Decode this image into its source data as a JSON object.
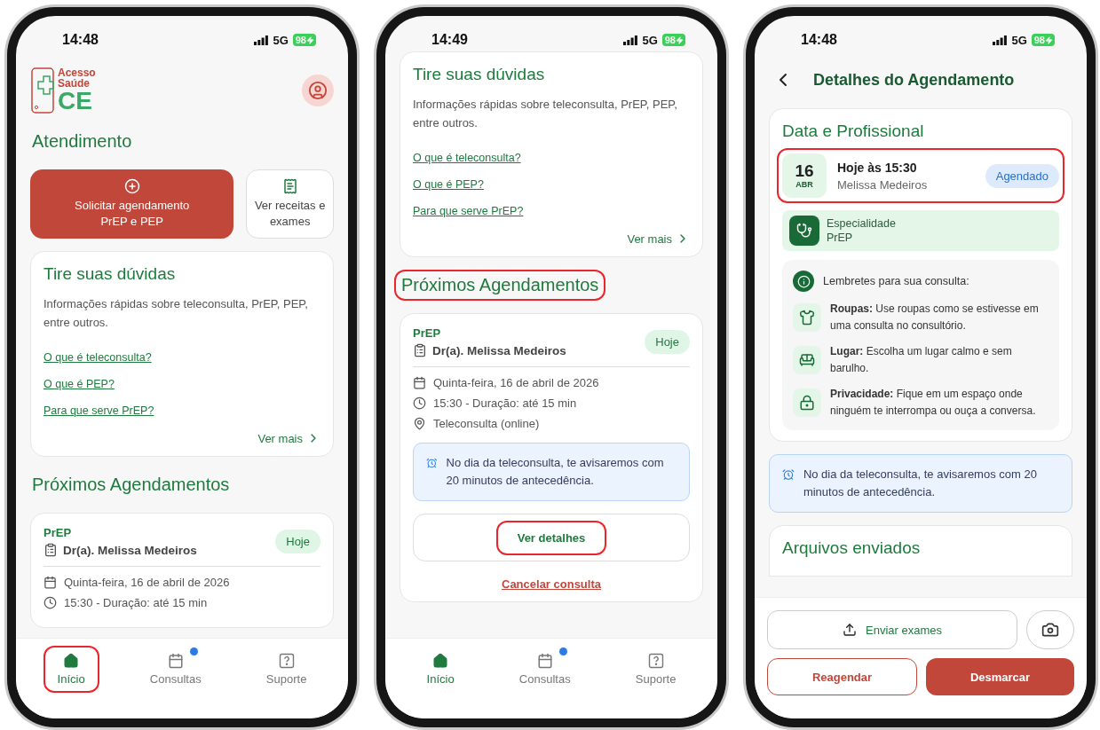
{
  "screens": [
    {
      "status": {
        "time": "14:48",
        "network": "5G",
        "battery": "98"
      },
      "blocks": [
        {
          "kind": "logo",
          "lines": [
            "Acesso",
            "Saúde",
            "CE"
          ]
        },
        {
          "kind": "heading",
          "text": "Atendimento",
          "highlighted": false
        },
        {
          "kind": "actions",
          "items": [
            {
              "label": "Solicitar agendamento PrEP e PEP",
              "primary": true
            },
            {
              "label": "Ver receitas e exames",
              "primary": false
            }
          ]
        },
        {
          "kind": "faq",
          "title": "Tire suas dúvidas",
          "text": "Informações rápidas sobre teleconsulta, PrEP, PEP, entre outros.",
          "links": [
            "O que é teleconsulta?",
            "O que é PEP?",
            "Para que serve PrEP?"
          ],
          "more": "Ver mais"
        },
        {
          "kind": "heading",
          "text": "Próximos Agendamentos",
          "highlighted": false
        },
        {
          "kind": "appointment",
          "type": "PrEP",
          "doctor": "Dr(a). Melissa Medeiros",
          "badge": "Hoje",
          "details": [
            "Quinta-feira, 16 de abril de 2026",
            "15:30 - Duração: até 15 min"
          ]
        }
      ],
      "tabs": [
        {
          "label": "Início",
          "selected": true,
          "highlighted": true,
          "dot": false
        },
        {
          "label": "Consultas",
          "selected": false,
          "highlighted": false,
          "dot": true
        },
        {
          "label": "Suporte",
          "selected": false,
          "highlighted": false,
          "dot": false
        }
      ]
    },
    {
      "status": {
        "time": "14:49",
        "network": "5G",
        "battery": "98"
      },
      "blocks": [
        {
          "kind": "faq",
          "title": "Tire suas dúvidas",
          "text": "Informações rápidas sobre teleconsulta, PrEP, PEP, entre outros.",
          "links": [
            "O que é teleconsulta?",
            "O que é PEP?",
            "Para que serve PrEP?"
          ],
          "more": "Ver mais"
        },
        {
          "kind": "heading",
          "text": "Próximos Agendamentos",
          "highlighted": true
        },
        {
          "kind": "appointment",
          "type": "PrEP",
          "doctor": "Dr(a). Melissa Medeiros",
          "badge": "Hoje",
          "details": [
            "Quinta-feira, 16 de abril de 2026",
            "15:30 - Duração: até 15 min",
            "Teleconsulta (online)"
          ],
          "notice": "No dia da teleconsulta, te avisaremos com 20 minutos de antecedência.",
          "button": {
            "label": "Ver detalhes",
            "highlighted": true
          },
          "cancel": "Cancelar consulta"
        }
      ],
      "tabs": [
        {
          "label": "Início",
          "selected": true,
          "highlighted": false,
          "dot": false
        },
        {
          "label": "Consultas",
          "selected": false,
          "highlighted": false,
          "dot": true
        },
        {
          "label": "Suporte",
          "selected": false,
          "highlighted": false,
          "dot": false
        }
      ]
    },
    {
      "status": {
        "time": "14:48",
        "network": "5G",
        "battery": "98"
      },
      "blocks": [
        {
          "kind": "nav",
          "title": "Detalhes do Agendamento"
        },
        {
          "kind": "detail",
          "title": "Data e Profissional",
          "day": "16",
          "month": "ABR",
          "when": "Hoje às 15:30",
          "who": "Melissa Medeiros",
          "status": "Agendado",
          "highlighted": true,
          "specialty_label": "Especialidade",
          "specialty": "PrEP",
          "reminders_title": "Lembretes para sua consulta:",
          "reminders": [
            "**Roupas:** Use roupas como se estivesse em uma consulta no consultório.",
            "**Lugar:** Escolha um lugar calmo e sem barulho.",
            "**Privacidade:** Fique em um espaço onde ninguém te interrompa ou ouça a conversa."
          ]
        },
        {
          "kind": "notice",
          "text": "No dia da teleconsulta, te avisaremos com 20 minutos de antecedência."
        },
        {
          "kind": "partial",
          "text": "Arquivos enviados"
        }
      ],
      "footer": {
        "upload": "Enviar exames",
        "secondary": "Reagendar",
        "primary": "Desmarcar"
      }
    }
  ]
}
